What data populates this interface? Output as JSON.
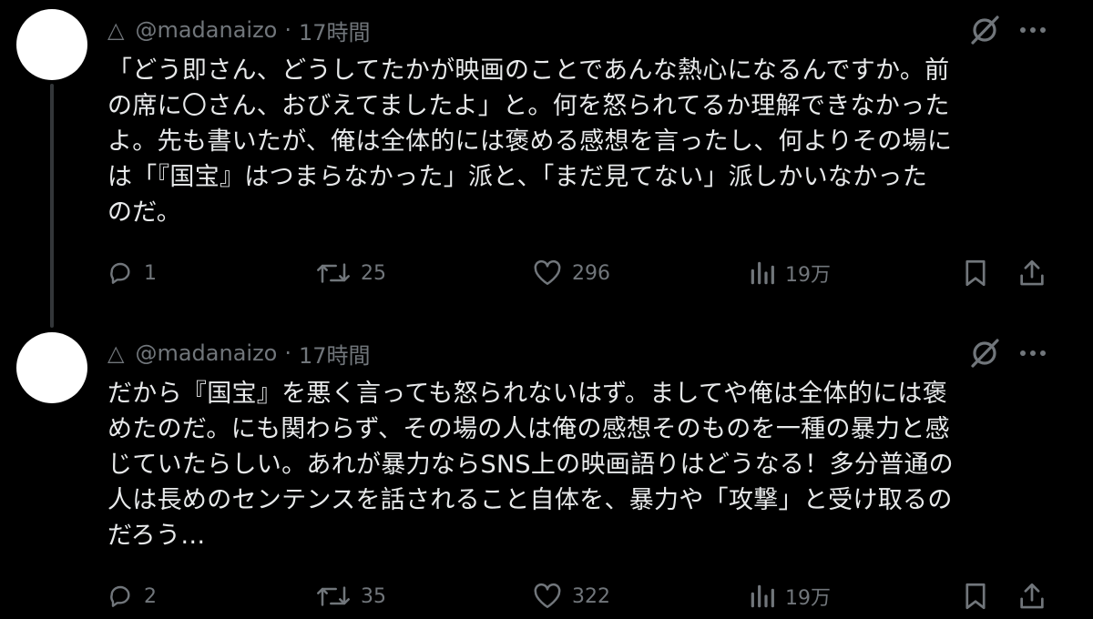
{
  "tweets": [
    {
      "handle_prefix": "△",
      "handle": "@madanaizo",
      "separator": "·",
      "time": "17時間",
      "lines": [
        "「どう即さん、どうしてたかが映画のことであんな熱心になるんですか。前",
        "の席に〇さん、おびえてましたよ」と。何を怒られてるか理解できなかった",
        "よ。先も書いたが、俺は全体的には褒める感想を言ったし、何よりその場に",
        "は「『国宝』はつまらなかった」派と、「まだ見てない」派しかいなかった",
        "のだ。"
      ],
      "replies": "1",
      "retweets": "25",
      "likes": "296",
      "views": "19万"
    },
    {
      "handle_prefix": "△",
      "handle": "@madanaizo",
      "separator": "·",
      "time": "17時間",
      "lines": [
        "だから『国宝』を悪く言っても怒られないはず。ましてや俺は全体的には褒",
        "めたのだ。にも関わらず、その場の人は俺の感想そのものを一種の暴力と感",
        "じていたらしい。あれが暴力ならSNS上の映画語りはどうなる！多分普通の",
        "人は長めのセンテンスを話されること自体を、暴力や「攻撃」と受け取るの",
        "だろう…"
      ],
      "replies": "2",
      "retweets": "35",
      "likes": "322",
      "views": "19万"
    }
  ]
}
